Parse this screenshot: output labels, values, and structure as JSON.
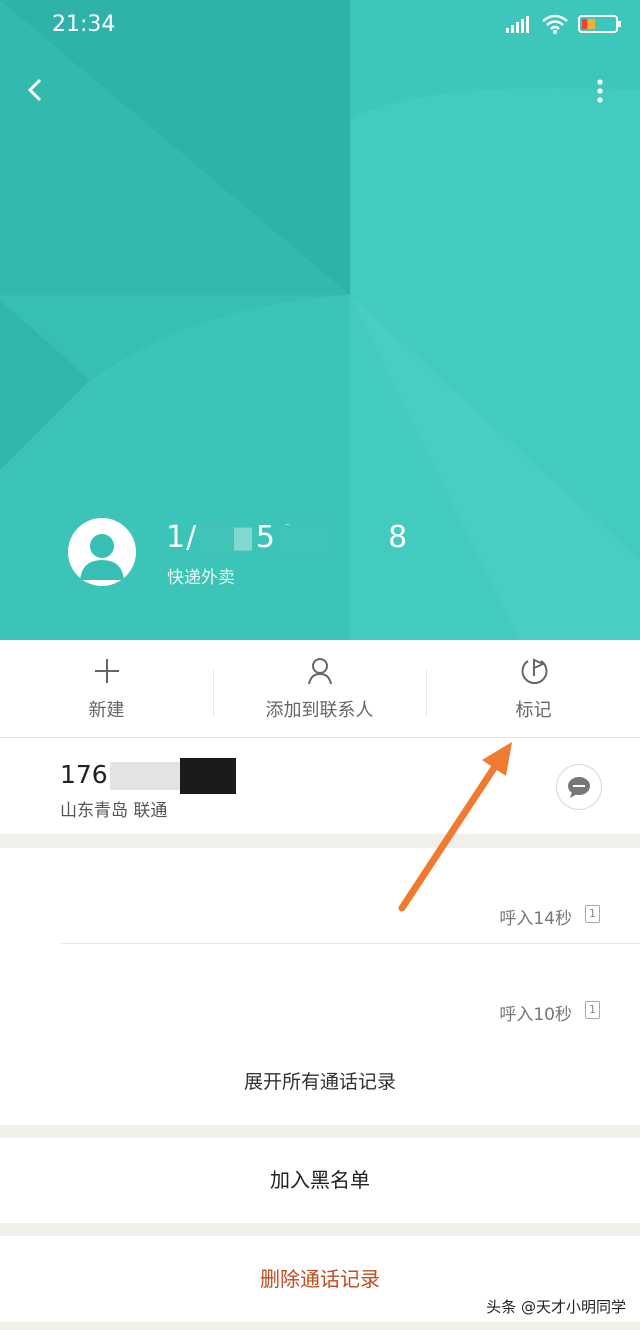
{
  "status_bar": {
    "time": "21:34"
  },
  "contact": {
    "number_display": "1/",
    "number_mid": "564",
    "number_end": "8",
    "tag": "快递外卖"
  },
  "actions": [
    {
      "label": "新建",
      "icon": "plus-icon"
    },
    {
      "label": "添加到联系人",
      "icon": "person-icon"
    },
    {
      "label": "标记",
      "icon": "flag-mark-icon"
    }
  ],
  "number_row": {
    "number": "176",
    "location": "山东青岛 联通"
  },
  "call_log": [
    {
      "info": "呼入14秒",
      "sim": "1"
    },
    {
      "info": "呼入10秒",
      "sim": "1"
    }
  ],
  "buttons": {
    "expand": "展开所有通话记录",
    "blacklist": "加入黑名单",
    "delete": "删除通话记录"
  },
  "watermark": "头条 @天才小明同学",
  "colors": {
    "header": "#37bfb4",
    "delete_text": "#c24b1f",
    "annotation_arrow": "#f07a2f"
  }
}
